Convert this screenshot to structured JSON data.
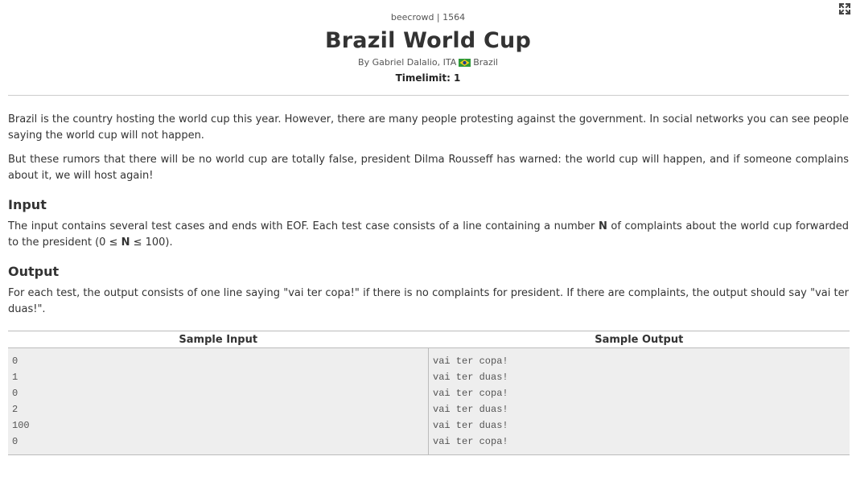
{
  "header": {
    "crumb": "beecrowd | 1564",
    "title": "Brazil World Cup",
    "author_prefix": "By Gabriel Dalalio, ITA",
    "author_country": "Brazil",
    "timelimit": "Timelimit: 1"
  },
  "description": {
    "p1": "Brazil is the country hosting the world cup this year. However, there are many people protesting against the government. In social networks you can see people saying the world cup will not happen.",
    "p2": "But these rumors that there will be no world cup are totally false, president Dilma Rousseff has warned: the world cup will happen, and if someone complains about it, we will host again!"
  },
  "input": {
    "heading": "Input",
    "text_before": "The input contains several test cases and ends with EOF. Each test case consists of a line containing a number ",
    "var": "N",
    "text_mid": " of complaints about the world cup forwarded to the president (0 ≤ ",
    "var2": "N",
    "text_after": " ≤ 100)."
  },
  "output": {
    "heading": "Output",
    "text": "For each test, the output consists of one line saying \"vai ter copa!\" if there is no complaints for president. If there are complaints, the output should say \"vai ter duas!\"."
  },
  "samples": {
    "input_header": "Sample Input",
    "output_header": "Sample Output",
    "input_lines": [
      "0",
      "1",
      "0",
      "2",
      "100",
      "0"
    ],
    "output_lines": [
      "vai ter copa!",
      "vai ter duas!",
      "vai ter copa!",
      "vai ter duas!",
      "vai ter duas!",
      "vai ter copa!"
    ]
  },
  "icons": {
    "expand": "expand-fullscreen-icon",
    "flag": "brazil-flag-icon"
  },
  "colors": {
    "text": "#333333",
    "rule": "#cccccc",
    "sample_bg": "#eeeeee",
    "flag_green": "#2e9a3a",
    "flag_yellow": "#f7d117",
    "flag_blue": "#1f3f8f"
  }
}
